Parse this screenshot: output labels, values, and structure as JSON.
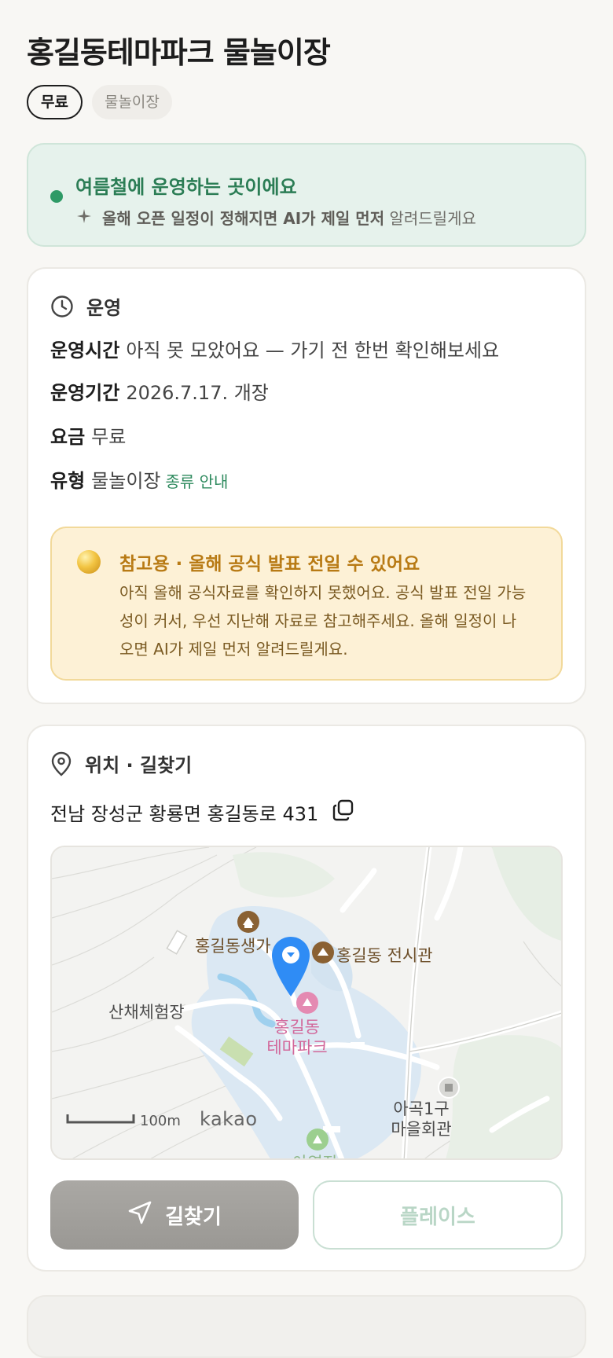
{
  "header": {
    "title": "홍길동테마파크 물놀이장",
    "chips": [
      "무료",
      "물놀이장"
    ]
  },
  "season_banner": {
    "headline": "여름철에 운영하는 곳이에요",
    "sub_bold": "올해 오픈 일정이 정해지면 AI가 제일 먼저",
    "sub_rest": "알려드릴게요",
    "accent_color": "#2e9a66"
  },
  "operation": {
    "section_title": "운영",
    "rows": {
      "hours": {
        "label": "운영시간",
        "value": "아직 못 모았어요 — 가기 전 한번 확인해보세요"
      },
      "period": {
        "label": "운영기간",
        "value": "2026.7.17. 개장"
      },
      "fee": {
        "label": "요금",
        "value": "무료"
      },
      "type": {
        "label": "유형",
        "value": "물놀이장",
        "link": "종류 안내"
      }
    },
    "notice": {
      "headline": "참고용 · 올해 공식 발표 전일 수 있어요",
      "body": "아직 올해 공식자료를 확인하지 못했어요. 공식 발표 전일 가능성이 커서, 우선 지난해 자료로 참고해주세요. 올해 일정이 나오면 AI가 제일 먼저 알려드릴게요."
    }
  },
  "location": {
    "section_title": "위치 · 길찾기",
    "address": "전남 장성군 황룡면 홍길동로 431",
    "map": {
      "labels": {
        "birthplace": "홍길동생가",
        "exhibition": "홍길동 전시관",
        "herb": "산채체험장",
        "park_line1": "홍길동",
        "park_line2": "테마파크",
        "village_line1": "아곡1구",
        "village_line2": "마을회관",
        "bottom_partial": "야영장"
      },
      "scale": "100m",
      "brand": "kakao",
      "marker_color": "#2f8cf5"
    },
    "buttons": {
      "directions": "길찾기",
      "place": "플레이스"
    }
  }
}
